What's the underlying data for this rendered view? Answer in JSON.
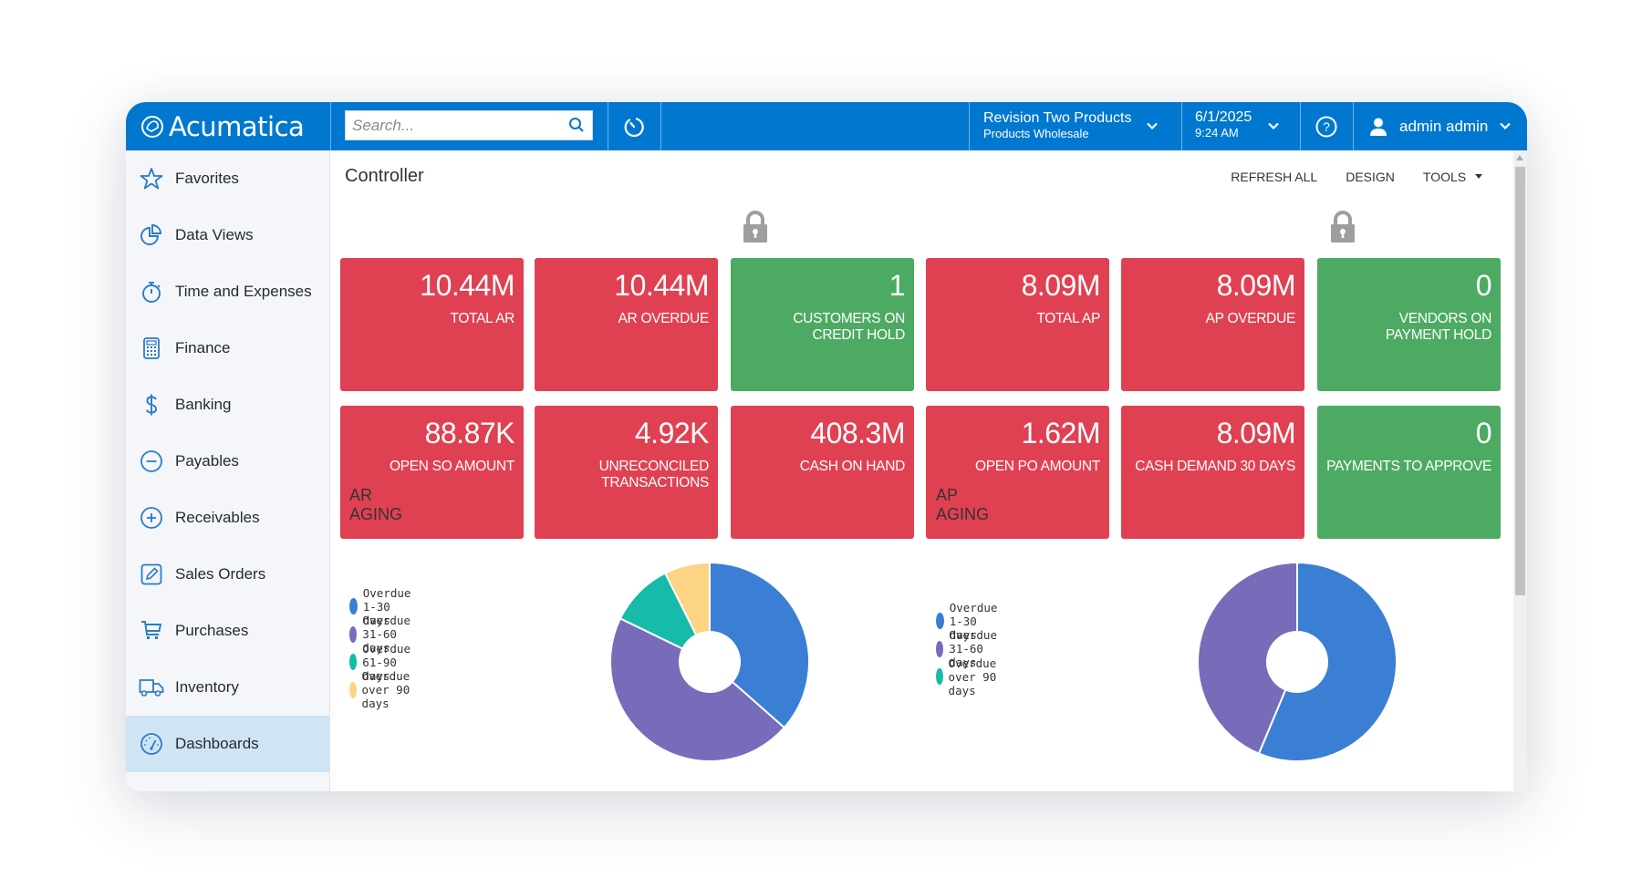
{
  "app": {
    "brand": "Acumatica",
    "search_placeholder": "Search...",
    "company_name": "Revision Two Products",
    "company_branch": "Products Wholesale",
    "date": "6/1/2025",
    "time": "9:24 AM",
    "user_name": "admin admin",
    "brand_color": "#0078cf"
  },
  "sidebar": {
    "items": [
      {
        "label": "Favorites",
        "icon": "star-icon"
      },
      {
        "label": "Data Views",
        "icon": "pie-chart-icon"
      },
      {
        "label": "Time and Expenses",
        "icon": "stopwatch-icon"
      },
      {
        "label": "Finance",
        "icon": "calculator-icon"
      },
      {
        "label": "Banking",
        "icon": "dollar-icon"
      },
      {
        "label": "Payables",
        "icon": "minus-circle-icon"
      },
      {
        "label": "Receivables",
        "icon": "plus-circle-icon"
      },
      {
        "label": "Sales Orders",
        "icon": "edit-icon"
      },
      {
        "label": "Purchases",
        "icon": "cart-icon"
      },
      {
        "label": "Inventory",
        "icon": "truck-icon"
      },
      {
        "label": "Dashboards",
        "icon": "gauge-icon",
        "active": true
      }
    ]
  },
  "page": {
    "title": "Controller",
    "toolbar": {
      "refresh_all": "REFRESH ALL",
      "design": "DESIGN",
      "tools": "TOOLS"
    }
  },
  "tiles": [
    {
      "value": "10.44M",
      "caption": "TOTAL AR",
      "status": "red"
    },
    {
      "value": "10.44M",
      "caption": "AR OVERDUE",
      "status": "red"
    },
    {
      "value": "1",
      "caption": "CUSTOMERS ON CREDIT HOLD",
      "status": "green"
    },
    {
      "value": "8.09M",
      "caption": "TOTAL AP",
      "status": "red"
    },
    {
      "value": "8.09M",
      "caption": "AP OVERDUE",
      "status": "red"
    },
    {
      "value": "0",
      "caption": "VENDORS ON PAYMENT HOLD",
      "status": "green"
    },
    {
      "value": "88.87K",
      "caption": "OPEN SO AMOUNT",
      "status": "red"
    },
    {
      "value": "4.92K",
      "caption": "UNRECONCILED TRANSACTIONS",
      "status": "red"
    },
    {
      "value": "408.3M",
      "caption": "CASH ON HAND",
      "status": "red"
    },
    {
      "value": "1.62M",
      "caption": "OPEN PO AMOUNT",
      "status": "red"
    },
    {
      "value": "8.09M",
      "caption": "CASH DEMAND 30 DAYS",
      "status": "red"
    },
    {
      "value": "0",
      "caption": "PAYMENTS TO APPROVE",
      "status": "green"
    }
  ],
  "status_colors": {
    "red": "#e04152",
    "green": "#4daa62"
  },
  "chart_data": [
    {
      "type": "pie",
      "variant": "donut",
      "title": "AR AGING",
      "legend_position": "left",
      "categories": [
        "Overdue 1-30 days",
        "Overdue 31-60 days",
        "Overdue 61-90 days",
        "Overdue over 90 days"
      ],
      "values": [
        36.5,
        45.7,
        10.4,
        7.4
      ],
      "unit": "percent (estimated)",
      "colors": [
        "#3a7fd4",
        "#766cb9",
        "#16bba9",
        "#fdd484"
      ]
    },
    {
      "type": "pie",
      "variant": "donut",
      "title": "AP AGING",
      "legend_position": "left",
      "categories": [
        "Overdue 1-30 days",
        "Overdue 31-60 days",
        "Overdue over 90 days"
      ],
      "values": [
        56.3,
        43.7,
        0
      ],
      "unit": "percent (estimated)",
      "colors": [
        "#3a7fd4",
        "#766cb9",
        "#16bba9"
      ]
    }
  ]
}
